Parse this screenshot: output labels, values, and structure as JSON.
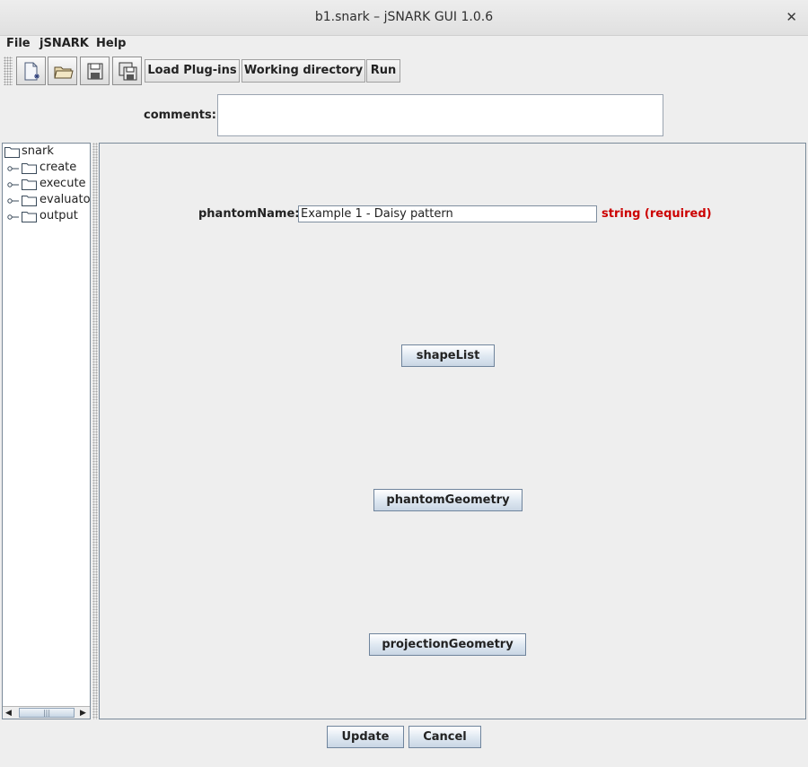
{
  "window": {
    "title": "b1.snark – jSNARK GUI 1.0.6",
    "close_glyph": "✕"
  },
  "menu": [
    "File",
    "jSNARK",
    "Help"
  ],
  "toolbar": {
    "icon_buttons": [
      "new-document-icon",
      "open-folder-icon",
      "save-icon",
      "save-as-icon"
    ],
    "load_plugins": "Load Plug-ins",
    "working_directory": "Working directory",
    "run": "Run"
  },
  "comments": {
    "label": "comments:",
    "value": ""
  },
  "tree": {
    "root": "snark",
    "children": [
      "create",
      "execute",
      "evaluator",
      "output"
    ]
  },
  "form": {
    "phantom_name": {
      "label": "phantomName:",
      "value": "Example 1 - Daisy pattern",
      "type": "string (required)"
    },
    "buttons": [
      "shapeList",
      "phantomGeometry",
      "projectionGeometry"
    ]
  },
  "footer": {
    "update": "Update",
    "cancel": "Cancel"
  }
}
